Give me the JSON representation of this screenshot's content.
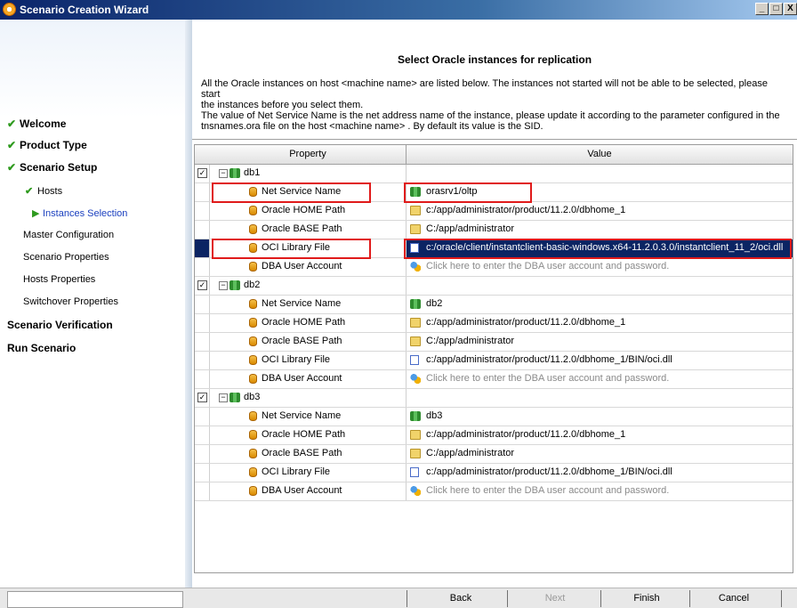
{
  "window": {
    "title": "Scenario Creation Wizard",
    "buttons": [
      "_",
      "□",
      "X"
    ]
  },
  "steps": [
    {
      "label": "Welcome",
      "level": "top",
      "done": true
    },
    {
      "label": "Product Type",
      "level": "top",
      "done": true
    },
    {
      "label": "Scenario Setup",
      "level": "top",
      "done": true
    },
    {
      "label": "Hosts",
      "level": "sub",
      "done": true
    },
    {
      "label": "Instances Selection",
      "level": "sub",
      "active": true
    },
    {
      "label": "Master Configuration",
      "level": "sub"
    },
    {
      "label": "Scenario Properties",
      "level": "sub"
    },
    {
      "label": "Hosts Properties",
      "level": "sub"
    },
    {
      "label": "Switchover Properties",
      "level": "sub"
    },
    {
      "label": "Scenario Verification",
      "level": "top"
    },
    {
      "label": "Run Scenario",
      "level": "top"
    }
  ],
  "header": {
    "title": "Select Oracle instances for replication",
    "line1": "All the Oracle instances on host  <machine name>    are listed below. The instances not started will not be able to be selected, please start",
    "line2": "the instances before you select them.",
    "line3": "The value of Net Service Name is the net address name of the instance, please update it according to the parameter configured in the",
    "line4": "tnsnames.ora file on the host  <machine name>  .  By default its value is the SID."
  },
  "grid": {
    "col_property": "Property",
    "col_value": "Value",
    "instances": [
      {
        "name": "db1",
        "checked": true,
        "props": [
          {
            "label": "Net Service Name",
            "icon": "db-icon",
            "value": "orasrv1/oltp"
          },
          {
            "label": "Oracle HOME Path",
            "icon": "folder-icon",
            "value": "c:/app/administrator/product/11.2.0/dbhome_1"
          },
          {
            "label": "Oracle BASE Path",
            "icon": "folder-icon",
            "value": "C:/app/administrator"
          },
          {
            "label": "OCI Library File",
            "icon": "file-icon",
            "value": "c:/oracle/client/instantclient-basic-windows.x64-11.2.0.3.0/instantclient_11_2/oci.dll",
            "selected": true
          },
          {
            "label": "DBA User Account",
            "icon": "user-icon",
            "value": "Click here to enter the DBA user account and password.",
            "hint": true
          }
        ]
      },
      {
        "name": "db2",
        "checked": true,
        "props": [
          {
            "label": "Net Service Name",
            "icon": "db-icon",
            "value": "db2"
          },
          {
            "label": "Oracle HOME Path",
            "icon": "folder-icon",
            "value": "c:/app/administrator/product/11.2.0/dbhome_1"
          },
          {
            "label": "Oracle BASE Path",
            "icon": "folder-icon",
            "value": "C:/app/administrator"
          },
          {
            "label": "OCI Library File",
            "icon": "file-icon",
            "value": "c:/app/administrator/product/11.2.0/dbhome_1/BIN/oci.dll"
          },
          {
            "label": "DBA User Account",
            "icon": "user-icon",
            "value": "Click here to enter the DBA user account and password.",
            "hint": true
          }
        ]
      },
      {
        "name": "db3",
        "checked": true,
        "props": [
          {
            "label": "Net Service Name",
            "icon": "db-icon",
            "value": "db3"
          },
          {
            "label": "Oracle HOME Path",
            "icon": "folder-icon",
            "value": "c:/app/administrator/product/11.2.0/dbhome_1"
          },
          {
            "label": "Oracle BASE Path",
            "icon": "folder-icon",
            "value": "C:/app/administrator"
          },
          {
            "label": "OCI Library File",
            "icon": "file-icon",
            "value": "c:/app/administrator/product/11.2.0/dbhome_1/BIN/oci.dll"
          },
          {
            "label": "DBA User Account",
            "icon": "user-icon",
            "value": "Click here to enter the DBA user account and password.",
            "hint": true
          }
        ]
      }
    ]
  },
  "buttons": {
    "back": "Back",
    "next": "Next",
    "finish": "Finish",
    "cancel": "Cancel"
  },
  "colors": {
    "selection": "#0b2463",
    "highlight": "#e01a1a",
    "active_step": "#1a3fbf",
    "check": "#2e9a1e"
  }
}
